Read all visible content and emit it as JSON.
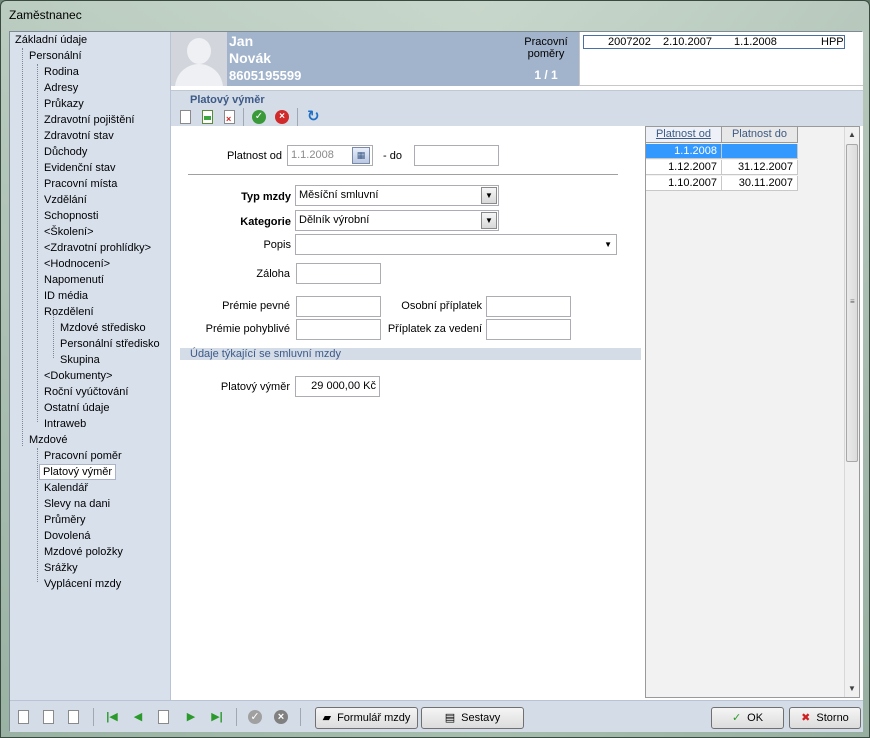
{
  "window": {
    "title": "Zaměstnanec"
  },
  "tree": {
    "items": [
      "Základní údaje",
      "Personální",
      "Rodina",
      "Adresy",
      "Průkazy",
      "Zdravotní pojištění",
      "Zdravotní stav",
      "Důchody",
      "Evidenční stav",
      "Pracovní místa",
      "Vzdělání",
      "Schopnosti",
      "<Školení>",
      "<Zdravotní prohlídky>",
      "<Hodnocení>",
      "Napomenutí",
      "ID média",
      "Rozdělení",
      "Mzdové středisko",
      "Personální středisko",
      "Skupina",
      "<Dokumenty>",
      "Roční vyúčtování",
      "Ostatní údaje",
      "Intraweb",
      "Mzdové",
      "Pracovní poměr",
      "Platový výměr",
      "Kalendář",
      "Slevy na dani",
      "Průměry",
      "Dovolená",
      "Mzdové položky",
      "Srážky",
      "Vyplácení mzdy"
    ],
    "selected": "Platový výměr"
  },
  "employee": {
    "first_name": "Jan",
    "last_name": "Novák",
    "id_number": "8605195599",
    "relations_label_1": "Pracovní",
    "relations_label_2": "poměry",
    "relations_count": "1 / 1"
  },
  "relations": [
    {
      "number": "2007202",
      "start": "2.10.2007",
      "end": "1.1.2008",
      "type": "HPP"
    }
  ],
  "section": {
    "title": "Platový výměr"
  },
  "toolbar": {
    "icons": [
      "new-icon",
      "edit-icon",
      "delete-icon",
      "confirm-icon",
      "cancel-icon",
      "refresh-icon"
    ]
  },
  "form": {
    "valid_from_label": "Platnost od",
    "valid_from_value": "1.1.2008",
    "valid_to_label": "- do",
    "valid_to_value": "",
    "wage_type_label": "Typ mzdy",
    "wage_type_value": "Měsíční smluvní",
    "category_label": "Kategorie",
    "category_value": "Dělník výrobní",
    "description_label": "Popis",
    "description_value": "",
    "advance_label": "Záloha",
    "advance_value": "",
    "bonus_fixed_label": "Prémie pevné",
    "bonus_fixed_value": "",
    "bonus_variable_label": "Prémie pohyblivé",
    "bonus_variable_value": "",
    "personal_allowance_label": "Osobní příplatek",
    "personal_allowance_value": "",
    "management_allowance_label": "Příplatek za vedení",
    "management_allowance_value": "",
    "contract_section_label": "Údaje týkající se smluvní mzdy",
    "salary_label": "Platový výměr",
    "salary_value": "29 000,00 Kč"
  },
  "grid": {
    "columns": [
      "Platnost od",
      "Platnost do"
    ],
    "rows": [
      {
        "from": "1.1.2008",
        "to": ""
      },
      {
        "from": "1.12.2007",
        "to": "31.12.2007"
      },
      {
        "from": "1.10.2007",
        "to": "30.11.2007"
      }
    ],
    "selected_row": 0
  },
  "bottombar": {
    "wage_form_label": "Formulář mzdy",
    "reports_label": "Sestavy",
    "ok_label": "OK",
    "cancel_label": "Storno"
  },
  "colors": {
    "header_bg": "#a2b3cc",
    "section_title": "#3d5a86",
    "selection": "#3399ff"
  }
}
